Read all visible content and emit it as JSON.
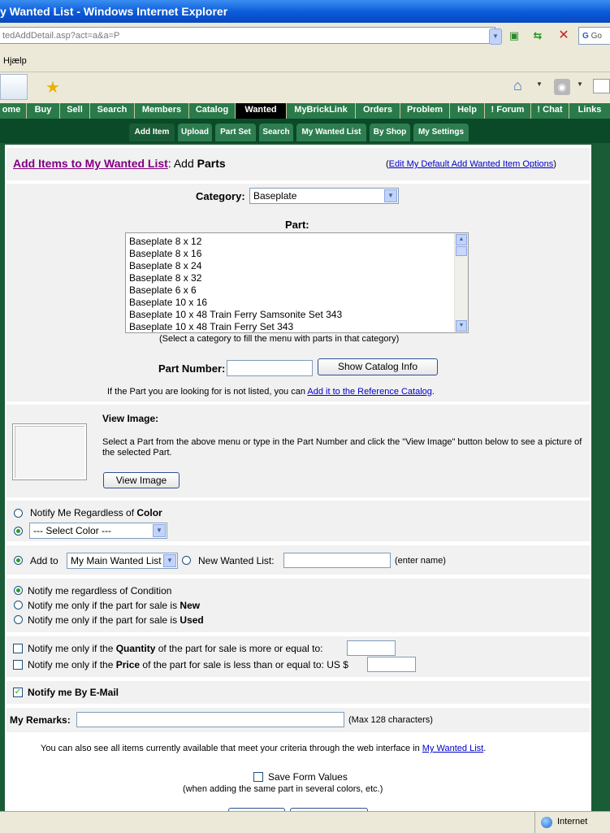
{
  "window": {
    "title": "y Wanted List - Windows Internet Explorer",
    "address": "tedAddDetail.asp?act=a&a=P",
    "menu_help": "Hjælp",
    "search_partial": "Go"
  },
  "sitenav": [
    "ome",
    "Buy",
    "Sell",
    "Search",
    "Members",
    "Catalog",
    "Wanted",
    "MyBrickLink",
    "Orders",
    "Problem",
    "Help",
    "! Forum",
    "! Chat",
    "Links"
  ],
  "subnav": [
    "Add Item",
    "Upload",
    "Part Set",
    "Search",
    "My Wanted List",
    "By Shop",
    "My Settings"
  ],
  "header": {
    "title_link": "Add Items to My Wanted List",
    "title_sep": ": Add ",
    "title_bold": "Parts",
    "edit_open": "(",
    "edit_link": "Edit My Default Add Wanted Item Options",
    "edit_close": ")"
  },
  "category": {
    "label": "Category:",
    "value": "Baseplate"
  },
  "part": {
    "label": "Part:",
    "items": [
      "Baseplate 8 x 12",
      "Baseplate 8 x 16",
      "Baseplate 8 x 24",
      "Baseplate 8 x 32",
      "Baseplate 6 x 6",
      "Baseplate 10 x 16",
      "Baseplate 10 x 48 Train Ferry Samsonite Set 343",
      "Baseplate 10 x 48 Train Ferry Set 343"
    ],
    "hint": "(Select a category to fill the menu with parts in that category)"
  },
  "part_number": {
    "label": "Part Number:",
    "value": "",
    "button": "Show Catalog Info"
  },
  "not_listed": {
    "text": "If the Part you are looking for is not listed, you can ",
    "link": "Add it to the Reference Catalog",
    "end": "."
  },
  "view_image": {
    "title": "View Image:",
    "desc": "Select a Part from the above menu or type in the Part Number and click the \"View Image\" button below to see a picture of the selected Part.",
    "button": "View Image"
  },
  "color": {
    "regardless_text": "Notify Me Regardless of ",
    "regardless_bold": "Color",
    "select_value": "--- Select Color ---"
  },
  "wanted_list": {
    "add_to": "Add to",
    "list_value": "My Main Wanted List",
    "new_label": "New Wanted List:",
    "new_value": "",
    "enter_name": "(enter name)"
  },
  "condition": {
    "regardless": "Notify me regardless of Condition",
    "new_text": "Notify me only if the part for sale is ",
    "new_bold": "New",
    "used_text": "Notify me only if the part for sale is ",
    "used_bold": "Used"
  },
  "quantity": {
    "pre": "Notify me only if the ",
    "bold": "Quantity",
    "post": " of the part for sale is more or equal to:",
    "value": ""
  },
  "price": {
    "pre": "Notify me only if the ",
    "bold": "Price",
    "post": " of the part for sale is less than or equal to: US $",
    "value": ""
  },
  "email": {
    "label": "Notify me By E-Mail"
  },
  "remarks": {
    "label": "My Remarks:",
    "value": "",
    "max": "(Max 128 characters)"
  },
  "also": {
    "text": "You can also see all items currently available that meet your criteria through the web interface in ",
    "link": "My Wanted List",
    "end": "."
  },
  "save_form": {
    "label": "Save Form Values",
    "hint": "(when adding the same part in several colors, etc.)"
  },
  "status": {
    "zone": "Internet"
  },
  "colors": {
    "site_green": "#1a5c36",
    "nav_green": "#0a4a28",
    "link_purple": "#800080"
  }
}
